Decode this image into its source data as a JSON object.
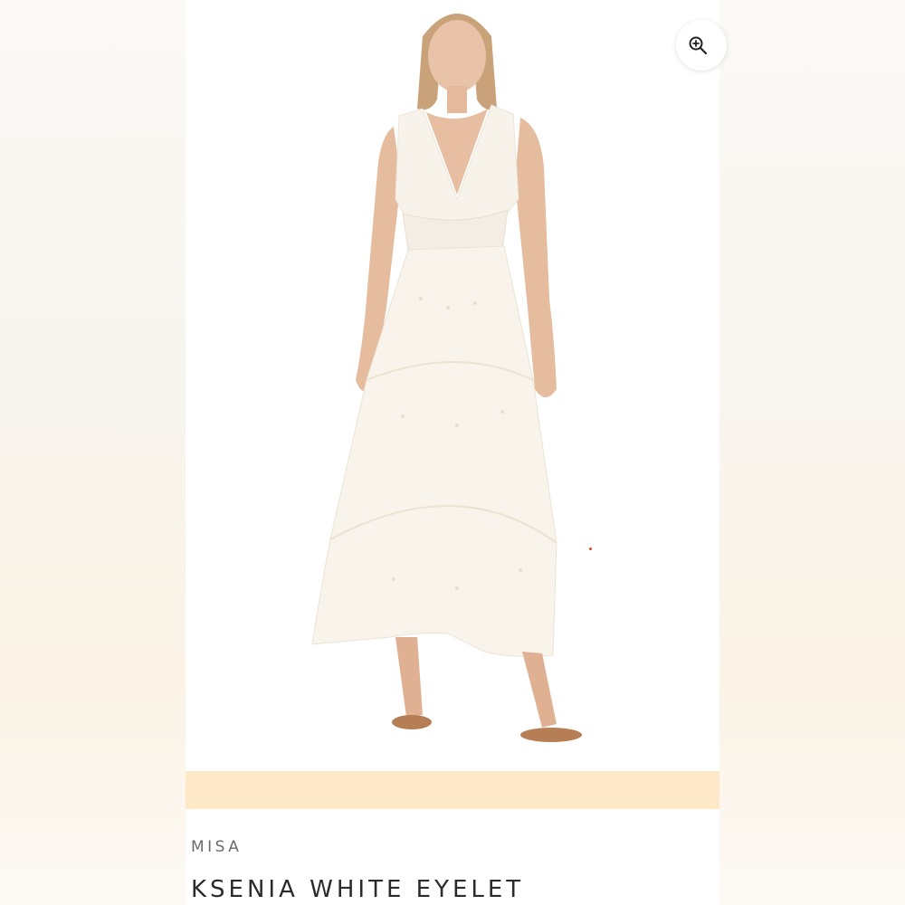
{
  "product": {
    "brand": "MISA",
    "title": "KSENIA WHITE EYELET"
  },
  "icons": {
    "zoom": "zoom-in-icon"
  },
  "colors": {
    "background": "#fbf8f4",
    "panel": "#ffffff",
    "peach_band": "#fde9c8",
    "brand_text": "#6b6b6b",
    "title_text": "#2b2b2b"
  }
}
